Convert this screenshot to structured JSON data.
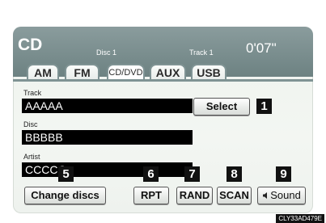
{
  "header": {
    "title": "CD",
    "disc_label": "Disc 1",
    "track_label": "Track  1",
    "elapsed_time": "0'07\""
  },
  "tabs": [
    {
      "label": "AM"
    },
    {
      "label": "FM"
    },
    {
      "label": "CD/DVD",
      "active": true
    },
    {
      "label": "AUX"
    },
    {
      "label": "USB"
    }
  ],
  "info": {
    "track_label": "Track",
    "track_value": "AAAAA",
    "disc_label": "Disc",
    "disc_value": "BBBBB",
    "artist_label": "Artist",
    "artist_value": "CCCCC"
  },
  "buttons": {
    "select": "Select",
    "change_discs": "Change discs",
    "rpt": "RPT",
    "rand": "RAND",
    "scan": "SCAN",
    "sound": "Sound"
  },
  "callouts": [
    "1",
    "5",
    "6",
    "7",
    "8",
    "9"
  ],
  "figure_code": "CLY33AD479E",
  "icons": {
    "sound": "speaker-icon"
  }
}
